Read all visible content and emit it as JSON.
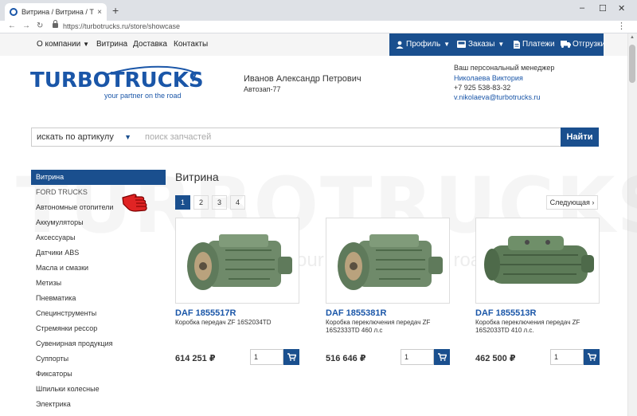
{
  "browser": {
    "tab_title": "Витрина / Витрина / TURBOTRU",
    "tab_close": "×",
    "new_tab": "+",
    "url": "https://turbotrucks.ru/store/showcase",
    "controls": {
      "minimize": "–",
      "maximize": "☐",
      "close": "✕",
      "menu": "⋮",
      "back": "←",
      "forward": "→",
      "reload": "↻"
    }
  },
  "topmenu": {
    "items": [
      "О компании",
      "Витрина",
      "Доставка",
      "Контакты"
    ],
    "chevron": "▼",
    "account": {
      "profile": "Профиль",
      "orders": "Заказы",
      "payments": "Платежи",
      "shipments": "Отгрузки"
    }
  },
  "logo": {
    "turbo": "TURBO",
    "trucks": "TRUCKS",
    "tagline": "your partner on the road"
  },
  "user": {
    "name": "Иванов Александр Петрович",
    "company": "Автозап-77"
  },
  "manager": {
    "title": "Ваш персональный менеджер",
    "name": "Николаева Виктория",
    "phone": "+7 925 538-83-32",
    "email": "v.nikolaeva@turbotrucks.ru"
  },
  "search": {
    "type_label": "искать по артикулу",
    "placeholder": "поиск запчастей",
    "button": "Найти"
  },
  "watermark": {
    "text": "TURBOTRUCKS",
    "tagline": "your partner on the road"
  },
  "sidebar": {
    "items": [
      "Витрина",
      "FORD TRUCKS",
      "Автономные отопители",
      "Аккумуляторы",
      "Аксессуары",
      "Датчики ABS",
      "Масла и смазки",
      "Метизы",
      "Пневматика",
      "Специнструменты",
      "Стремянки рессор",
      "Сувенирная продукция",
      "Суппорты",
      "Фиксаторы",
      "Шпильки колесные",
      "Электрика"
    ]
  },
  "main": {
    "title": "Витрина",
    "pages": [
      "1",
      "2",
      "3",
      "4"
    ],
    "next": "Следующая ›",
    "products": [
      {
        "name": "DAF 1855517R",
        "desc": "Коробка передач ZF 16S2034TD",
        "price": "614 251 ₽",
        "qty": "1"
      },
      {
        "name": "DAF 1855381R",
        "desc": "Коробка переключения передач ZF 16S2333TD 460 л.с",
        "price": "516 646 ₽",
        "qty": "1"
      },
      {
        "name": "DAF 1855513R",
        "desc": "Коробка переключения передач ZF 16S2033TD 410 л.с.",
        "price": "462 500 ₽",
        "qty": "1"
      }
    ]
  },
  "colors": {
    "brand": "#1a4f8e",
    "link": "#1a56a8",
    "gearbox": "#6f8a6a"
  },
  "icons": [
    "user-icon",
    "cart-icon",
    "document-icon",
    "truck-icon",
    "lock-icon",
    "pointer-hand-icon"
  ]
}
